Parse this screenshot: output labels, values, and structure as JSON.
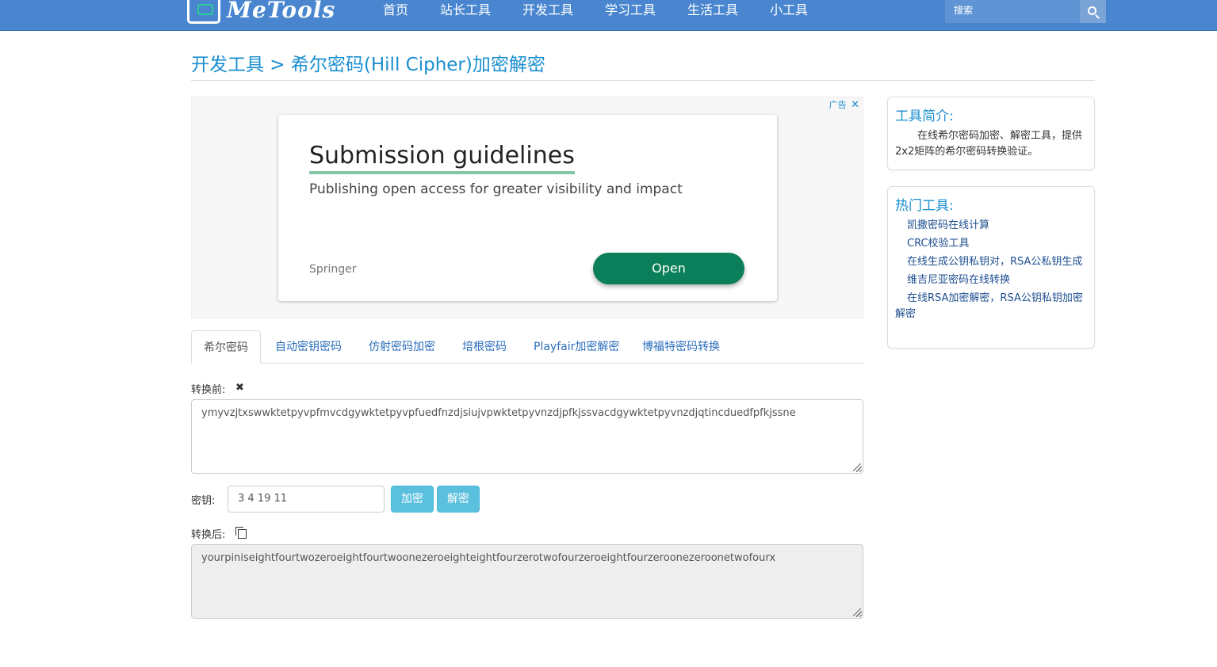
{
  "nav": {
    "logo_text": "MeTools",
    "items": [
      "首页",
      "站长工具",
      "开发工具",
      "学习工具",
      "生活工具",
      "小工具"
    ],
    "search_placeholder": "搜索"
  },
  "page": {
    "title": "开发工具 > 希尔密码(Hill Cipher)加密解密"
  },
  "ad": {
    "label": "广告",
    "close": "✕",
    "headline": "Submission guidelines",
    "subtitle": "Publishing open access for greater visibility and impact",
    "brand": "Springer",
    "cta": "Open",
    "colors": {
      "button": "#0a7f5a",
      "underline": "#84c7a8"
    }
  },
  "tabs": [
    "希尔密码",
    "自动密钥密码",
    "仿射密码加密",
    "培根密码",
    "Playfair加密解密",
    "博福特密码转换"
  ],
  "form": {
    "input_label": "转换前:",
    "input_value": "ymyvzjtxswwktetpyvpfmvcdgywktetpyvpfuedfnzdjsiujvpwktetpyvnzdjpfkjssvacdgywktetpyvnzdjqtincduedfpfkjssne",
    "key_label": "密钥:",
    "key_value": "3 4 19 11",
    "encrypt_label": "加密",
    "decrypt_label": "解密",
    "output_label": "转换后:",
    "output_value": "yourpiniseightfourtwozeroeightfourtwoonezeroeighteightfourzerotwofourzeroeightfourzeroonezeroonetwofourx"
  },
  "sidebar": {
    "intro_title": "工具简介:",
    "intro_text": "在线希尔密码加密、解密工具，提供2x2矩阵的希尔密码转换验证。",
    "hot_title": "热门工具:",
    "hot_links": [
      "凯撒密码在线计算",
      "CRC校验工具",
      "在线生成公钥私钥对，RSA公私钥生成",
      "维吉尼亚密码在线转换",
      "在线RSA加密解密，RSA公钥私钥加密解密"
    ]
  },
  "colors": {
    "nav_bg": "#4a86cf",
    "accent": "#1a8fd0",
    "button": "#5bc0de"
  }
}
